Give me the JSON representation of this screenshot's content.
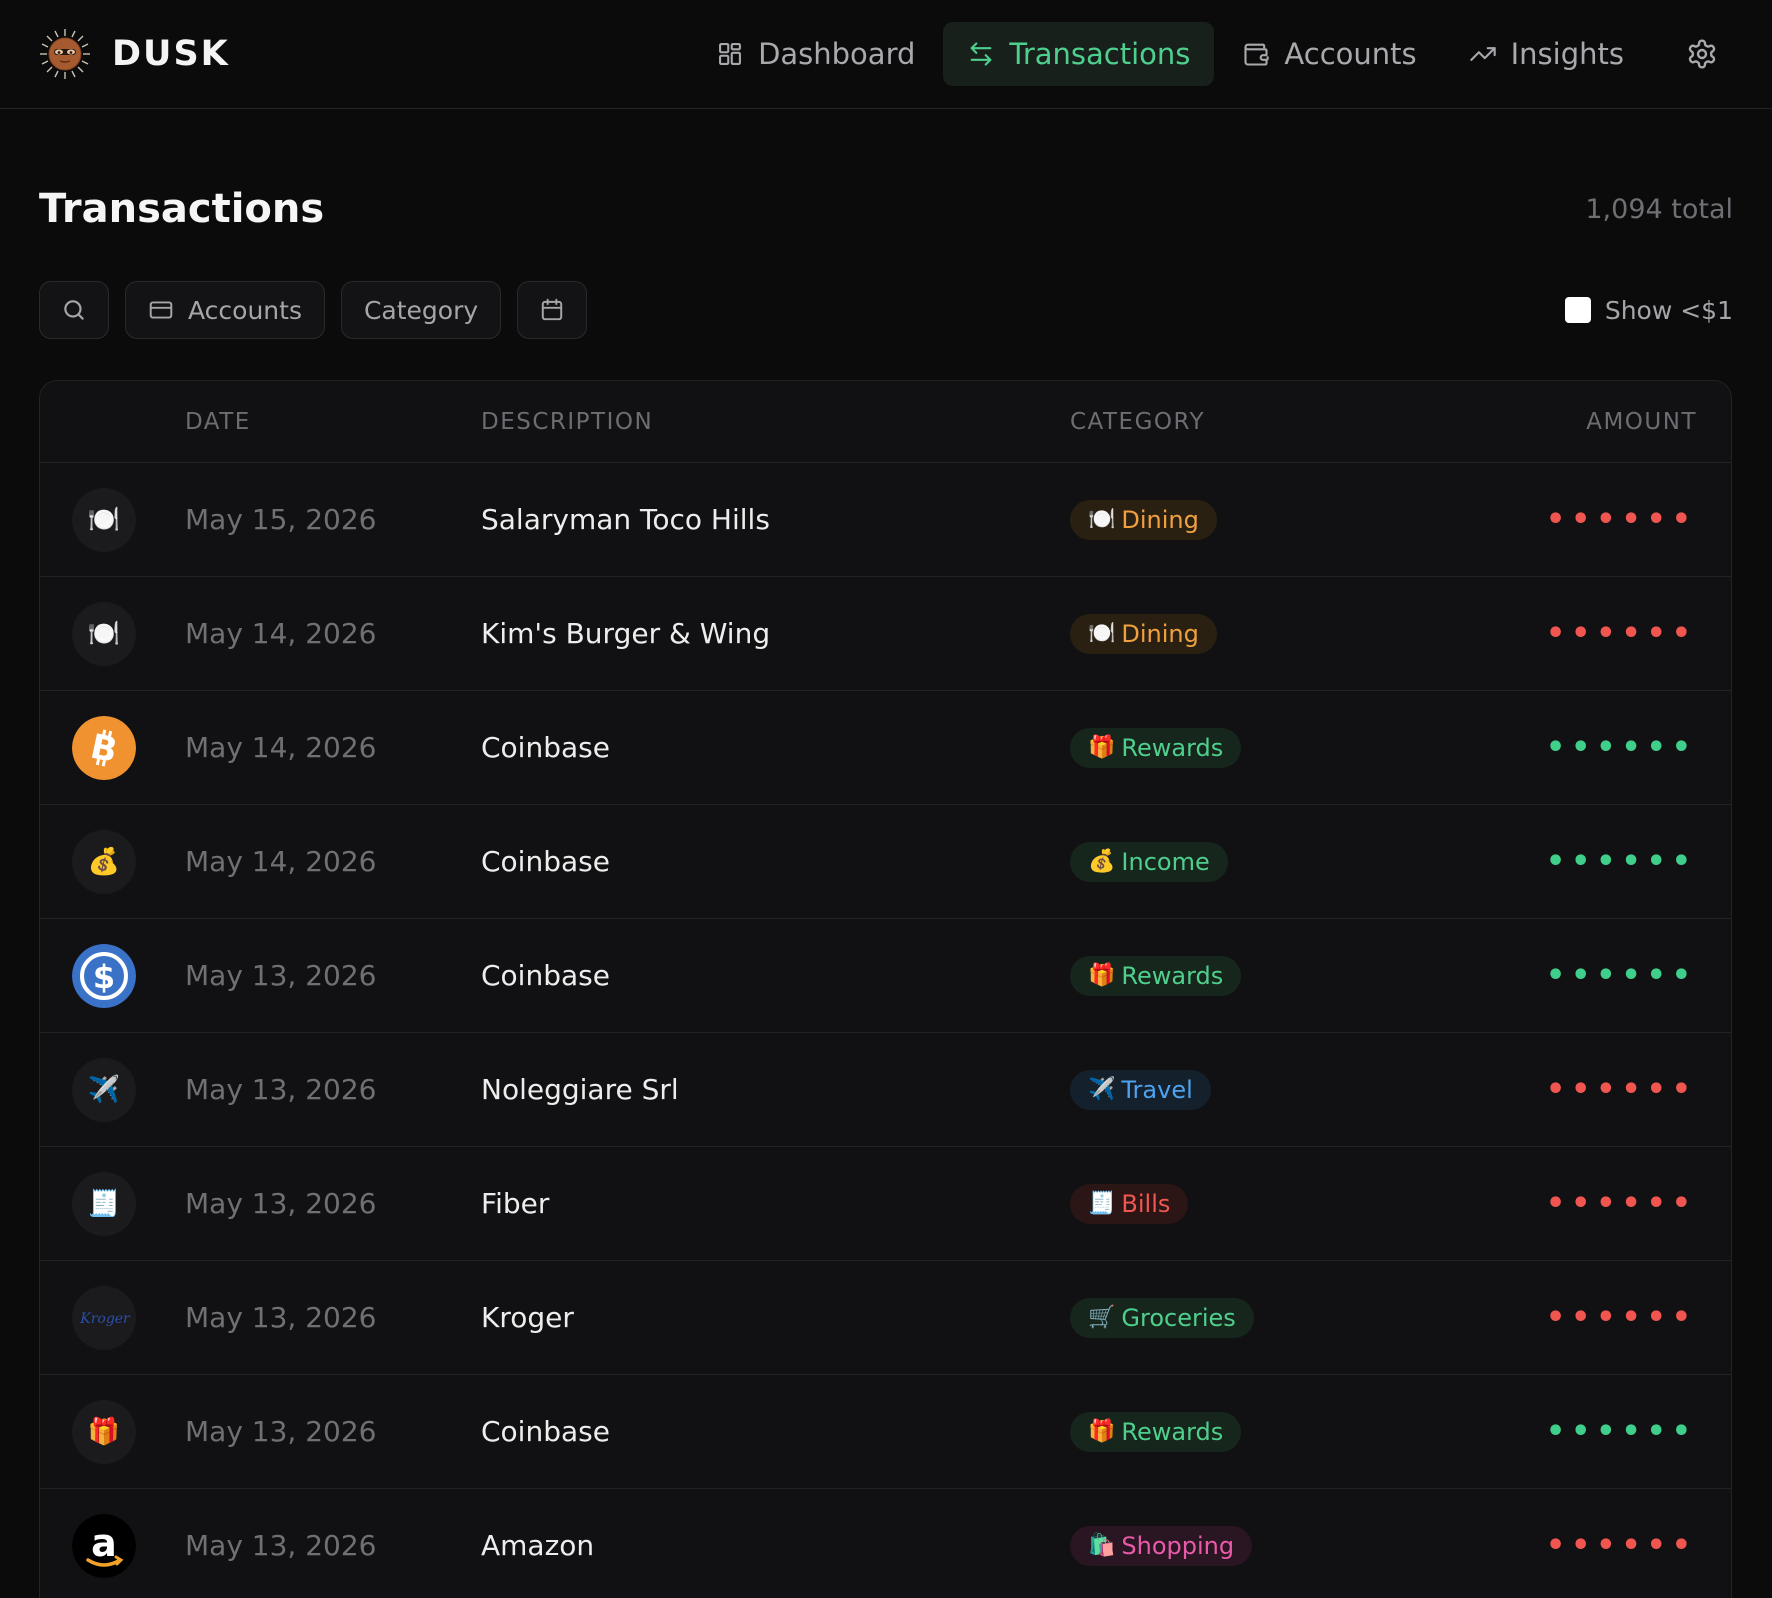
{
  "brand": {
    "name": "DUSK"
  },
  "nav": {
    "items": [
      {
        "label": "Dashboard",
        "icon": "grid-icon"
      },
      {
        "label": "Transactions",
        "icon": "swap-icon"
      },
      {
        "label": "Accounts",
        "icon": "wallet-icon"
      },
      {
        "label": "Insights",
        "icon": "trend-up-icon"
      }
    ],
    "settings_icon": "gear-icon"
  },
  "page": {
    "title": "Transactions",
    "total": "1,094 total"
  },
  "filters": {
    "search_icon": "search-icon",
    "accounts_label": "Accounts",
    "category_label": "Category",
    "date_icon": "calendar-icon",
    "small_toggle_label": "Show <$1",
    "small_toggle_checked": false
  },
  "table": {
    "headers": {
      "date": "DATE",
      "description": "DESCRIPTION",
      "category": "CATEGORY",
      "amount": "AMOUNT"
    },
    "rows": [
      {
        "icon": "🍽️",
        "icon_name": "plate-icon",
        "date": "May 15, 2026",
        "description": "Salaryman Toco Hills",
        "category": "Dining",
        "category_emoji": "🍽️",
        "amount": "••••••",
        "amount_type": "debit"
      },
      {
        "icon": "🍽️",
        "icon_name": "plate-icon",
        "date": "May 14, 2026",
        "description": "Kim's Burger & Wing",
        "category": "Dining",
        "category_emoji": "🍽️",
        "amount": "••••••",
        "amount_type": "debit"
      },
      {
        "icon": "bitcoin",
        "icon_name": "bitcoin-icon",
        "date": "May 14, 2026",
        "description": "Coinbase",
        "category": "Rewards",
        "category_emoji": "🎁",
        "amount": "••••••",
        "amount_type": "credit"
      },
      {
        "icon": "💰",
        "icon_name": "money-bag-icon",
        "date": "May 14, 2026",
        "description": "Coinbase",
        "category": "Income",
        "category_emoji": "💰",
        "amount": "••••••",
        "amount_type": "credit"
      },
      {
        "icon": "usdc",
        "icon_name": "usdc-icon",
        "date": "May 13, 2026",
        "description": "Coinbase",
        "category": "Rewards",
        "category_emoji": "🎁",
        "amount": "••••••",
        "amount_type": "credit"
      },
      {
        "icon": "✈️",
        "icon_name": "airplane-icon",
        "date": "May 13, 2026",
        "description": "Noleggiare Srl",
        "category": "Travel",
        "category_emoji": "✈️",
        "amount": "••••••",
        "amount_type": "debit"
      },
      {
        "icon": "🧾",
        "icon_name": "receipt-icon",
        "date": "May 13, 2026",
        "description": "Fiber",
        "category": "Bills",
        "category_emoji": "🧾",
        "amount": "••••••",
        "amount_type": "debit"
      },
      {
        "icon": "kroger",
        "icon_name": "kroger-logo-icon",
        "date": "May 13, 2026",
        "description": "Kroger",
        "category": "Groceries",
        "category_emoji": "🛒",
        "amount": "••••••",
        "amount_type": "debit"
      },
      {
        "icon": "🎁",
        "icon_name": "gift-icon",
        "date": "May 13, 2026",
        "description": "Coinbase",
        "category": "Rewards",
        "category_emoji": "🎁",
        "amount": "••••••",
        "amount_type": "credit"
      },
      {
        "icon": "amazon",
        "icon_name": "amazon-logo-icon",
        "date": "May 13, 2026",
        "description": "Amazon",
        "category": "Shopping",
        "category_emoji": "🛍️",
        "amount": "••••••",
        "amount_type": "debit"
      }
    ]
  },
  "colors": {
    "accent": "#4ecf8e",
    "debit": "#f0554f",
    "credit": "#3fcf8a",
    "category": {
      "Dining": {
        "fg": "#f0a040",
        "bg": "#2a2012"
      },
      "Rewards": {
        "fg": "#4fcf8c",
        "bg": "#16261d"
      },
      "Income": {
        "fg": "#4fcf8c",
        "bg": "#16261d"
      },
      "Travel": {
        "fg": "#4ea3f0",
        "bg": "#14202c"
      },
      "Bills": {
        "fg": "#f0574f",
        "bg": "#2b1515"
      },
      "Groceries": {
        "fg": "#4fcf8c",
        "bg": "#16261d"
      },
      "Shopping": {
        "fg": "#e95aa8",
        "bg": "#2a1523"
      }
    }
  }
}
